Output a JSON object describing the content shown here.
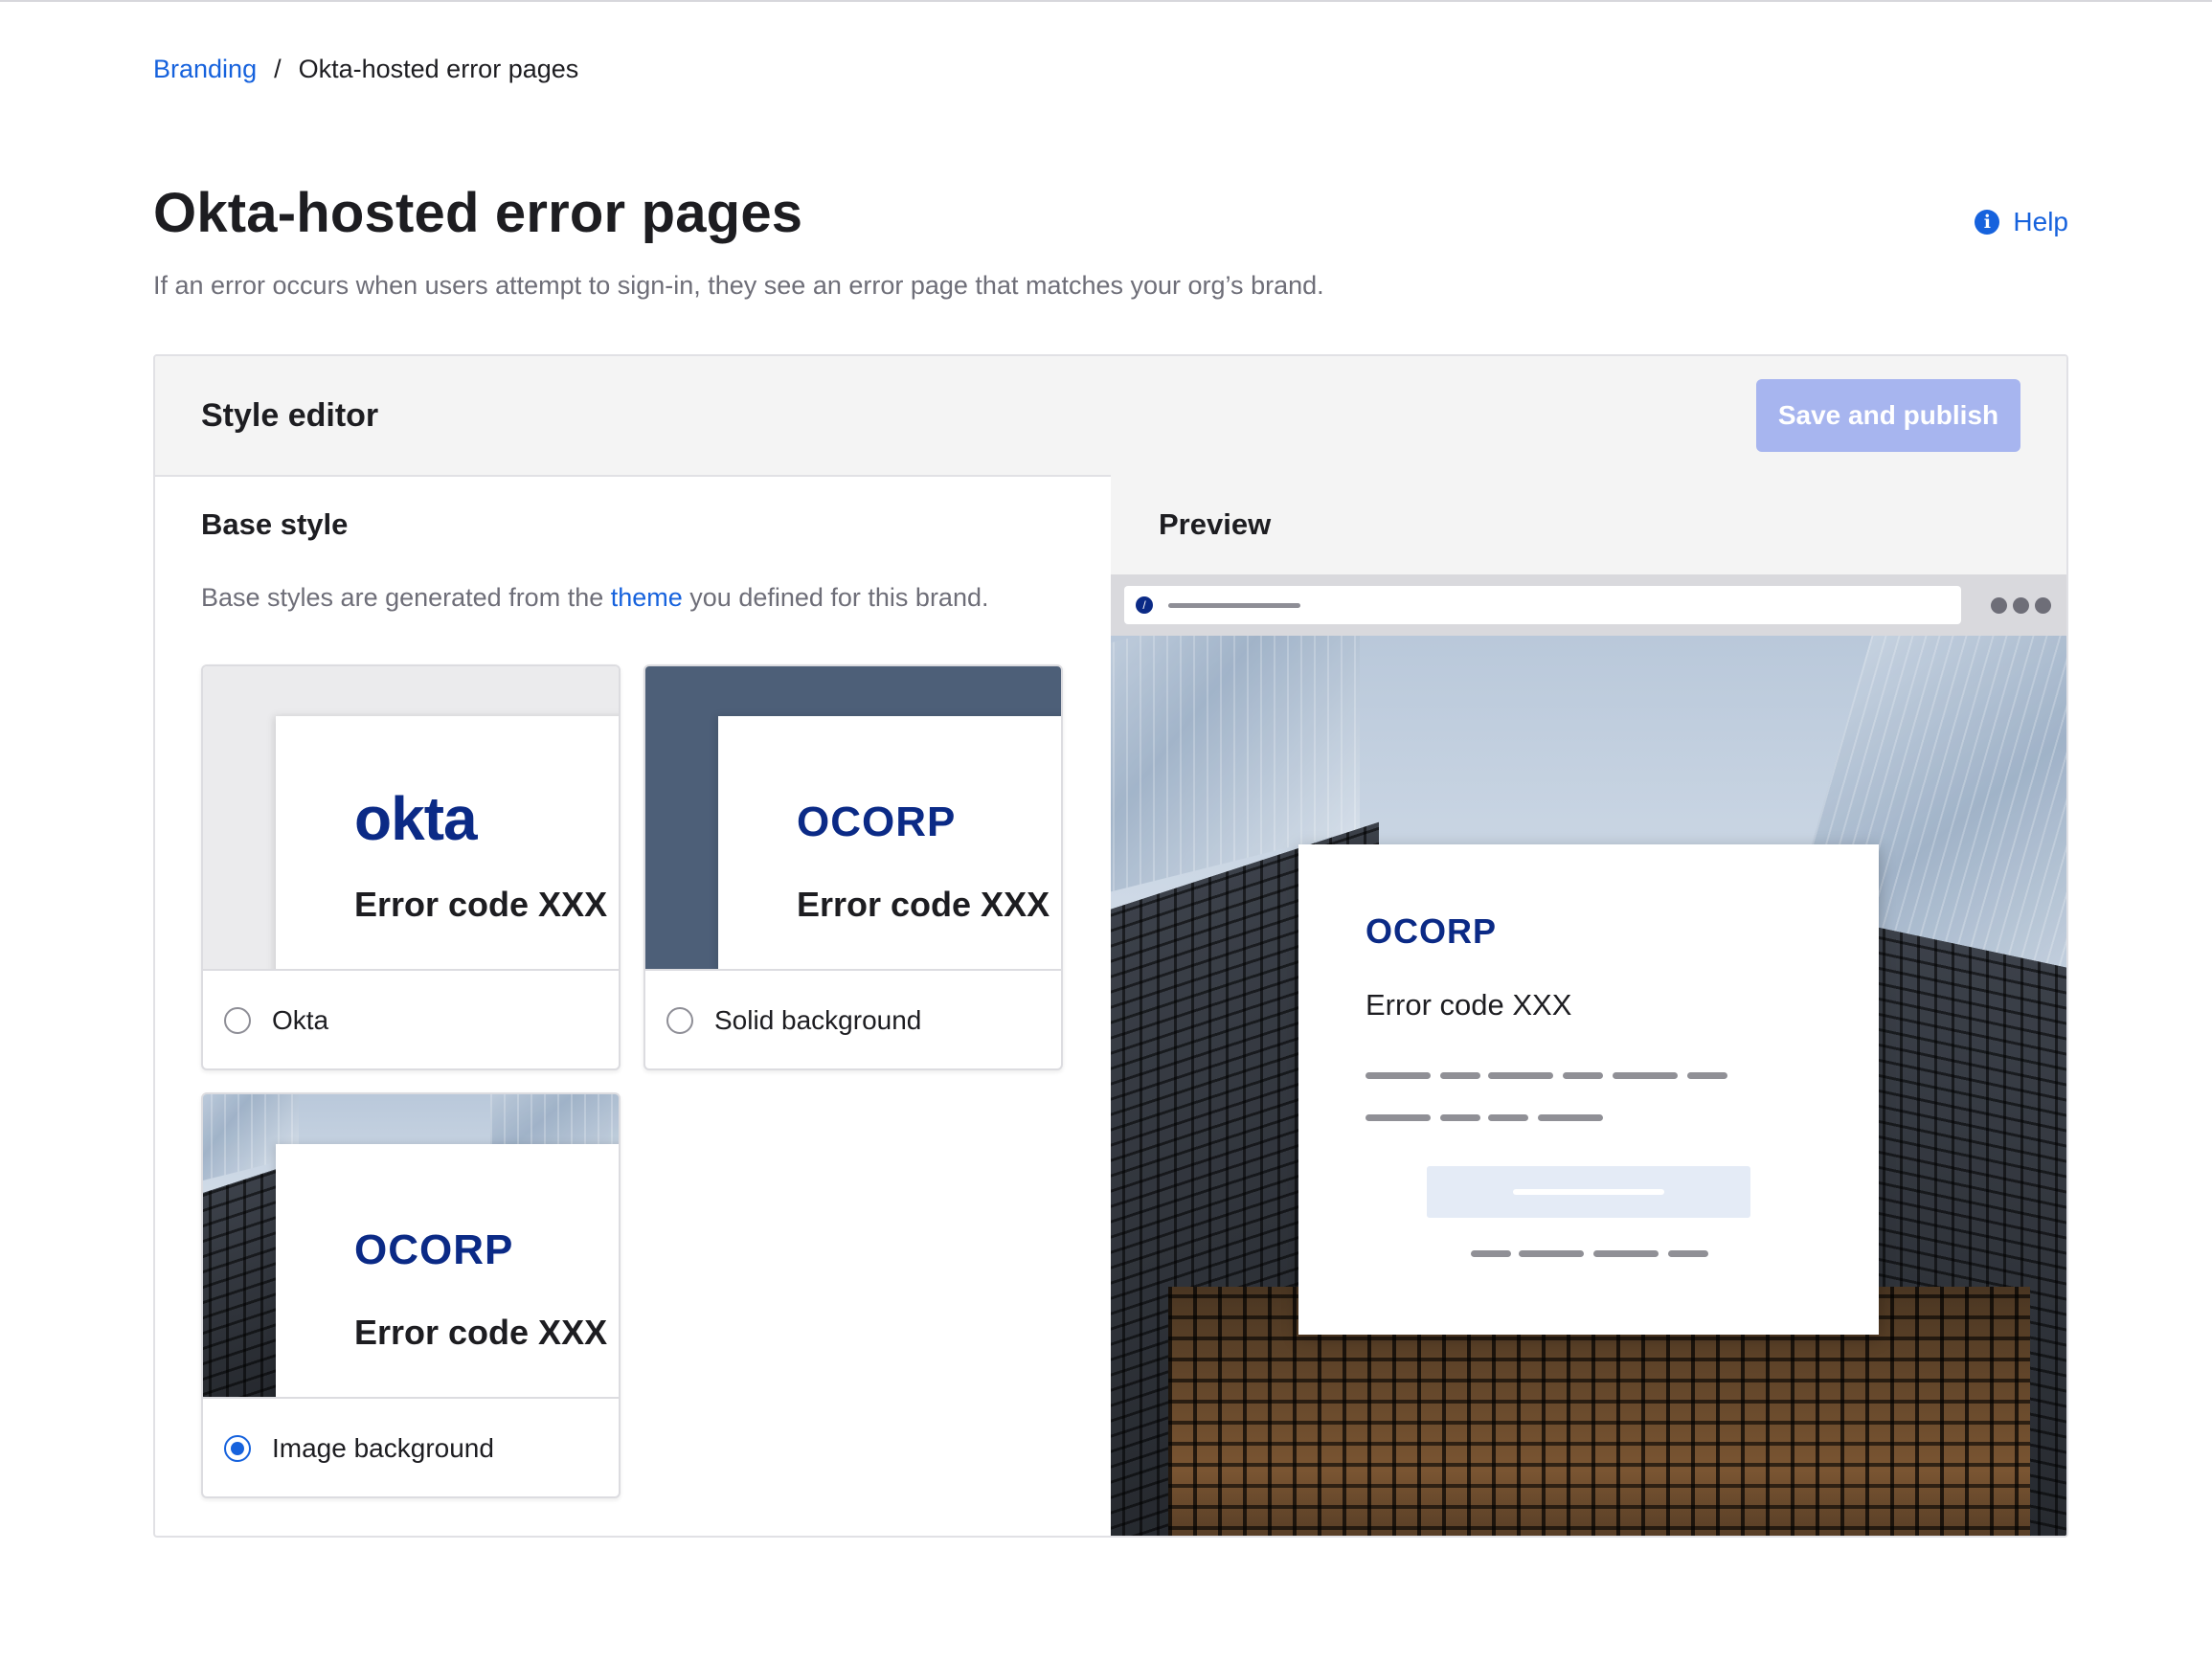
{
  "breadcrumb": {
    "parent": "Branding",
    "separator": "/",
    "current": "Okta-hosted error pages"
  },
  "header": {
    "title": "Okta-hosted error pages",
    "subtitle": "If an error occurs when users attempt to sign-in, they see an error page that matches your org’s brand.",
    "help_label": "Help",
    "help_icon": "info-circle-icon"
  },
  "editor": {
    "title": "Style editor",
    "save_label": "Save and publish",
    "save_enabled": false
  },
  "base_style": {
    "title": "Base style",
    "desc_before": "Base styles are generated from the ",
    "desc_link": "theme",
    "desc_after": " you defined for this brand.",
    "options": [
      {
        "label": "Okta",
        "logo": "okta",
        "error_text": "Error code XXX",
        "selected": false
      },
      {
        "label": "Solid background",
        "logo": "OCORP",
        "error_text": "Error code XXX",
        "selected": false
      },
      {
        "label": "Image background",
        "logo": "OCORP",
        "error_text": "Error code XXX",
        "selected": true
      }
    ]
  },
  "preview": {
    "title": "Preview",
    "logo": "OCORP",
    "error_text": "Error code XXX"
  },
  "colors": {
    "link": "#1662dd",
    "brand_logo": "#0b2a86",
    "button_disabled": "#a7b5ef",
    "solid_background": "#4d5f78"
  }
}
